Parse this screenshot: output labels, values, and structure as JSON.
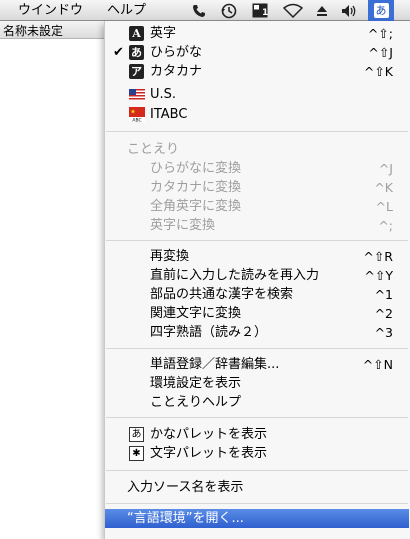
{
  "menubar": {
    "window_label": "ウインドウ",
    "help_label": "ヘルプ",
    "input_menu_glyph": "あ",
    "status_icons": [
      "phone-icon",
      "time-machine-icon",
      "spaces-icon",
      "wifi-icon",
      "eject-icon",
      "volume-icon"
    ]
  },
  "background_window": {
    "title": "名称未設定"
  },
  "menu": {
    "input_modes": [
      {
        "label": "英字",
        "shortcut": "^⇧;",
        "icon": "A",
        "checked": false
      },
      {
        "label": "ひらがな",
        "shortcut": "^⇧J",
        "icon": "あ",
        "checked": true
      },
      {
        "label": "カタカナ",
        "shortcut": "^⇧K",
        "icon": "ア",
        "checked": false
      },
      {
        "label": "U.S.",
        "shortcut": "",
        "icon": "us-flag",
        "checked": false
      },
      {
        "label": "ITABC",
        "shortcut": "",
        "icon": "itabc-flag",
        "checked": false
      }
    ],
    "kotoeri_header": "ことえり",
    "conversion_items": [
      {
        "label": "ひらがなに変換",
        "shortcut": "^J"
      },
      {
        "label": "カタカナに変換",
        "shortcut": "^K"
      },
      {
        "label": "全角英字に変換",
        "shortcut": "^L"
      },
      {
        "label": "英字に変換",
        "shortcut": "^;"
      }
    ],
    "reconvert_items": [
      {
        "label": "再変換",
        "shortcut": "^⇧R"
      },
      {
        "label": "直前に入力した読みを再入力",
        "shortcut": "^⇧Y"
      },
      {
        "label": "部品の共通な漢字を検索",
        "shortcut": "^1"
      },
      {
        "label": "関連文字に変換",
        "shortcut": "^2"
      },
      {
        "label": "四字熟語（読み２）",
        "shortcut": "^3"
      }
    ],
    "dictionary_items": [
      {
        "label": "単語登録／辞書編集...",
        "shortcut": "^⇧N"
      },
      {
        "label": "環境設定を表示",
        "shortcut": ""
      },
      {
        "label": "ことえりヘルプ",
        "shortcut": ""
      }
    ],
    "palette_items": [
      {
        "label": "かなパレットを表示",
        "icon": "あ"
      },
      {
        "label": "文字パレットを表示",
        "icon": "✱"
      }
    ],
    "show_source_name": "入力ソース名を表示",
    "open_language": "“言語環境”を開く..."
  }
}
